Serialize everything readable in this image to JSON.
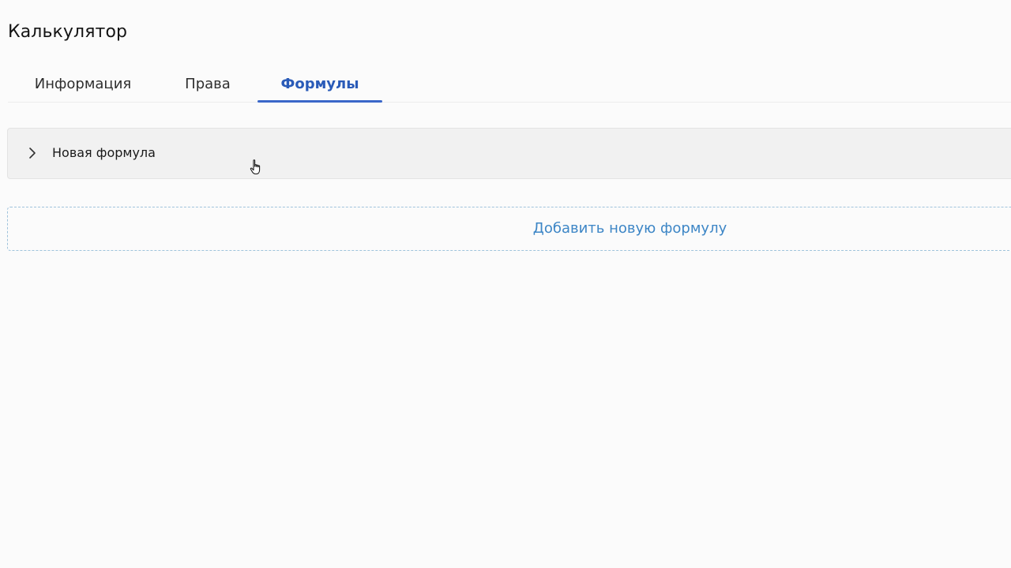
{
  "page": {
    "title": "Калькулятор"
  },
  "tabs": [
    {
      "label": "Информация",
      "active": false
    },
    {
      "label": "Права",
      "active": false
    },
    {
      "label": "Формулы",
      "active": true
    }
  ],
  "formulas": {
    "panels": [
      {
        "title": "Новая формула",
        "expanded": false,
        "icon": "chevron-right-icon"
      }
    ],
    "add_button_label": "Добавить новую формулу"
  },
  "colors": {
    "accent": "#3a67c9",
    "active_tab_text": "#2a5bb8",
    "add_button_text": "#3d86c6",
    "add_button_border": "#9fc3dc",
    "panel_background": "#f1f1f1",
    "page_background": "#fbfbfb"
  }
}
